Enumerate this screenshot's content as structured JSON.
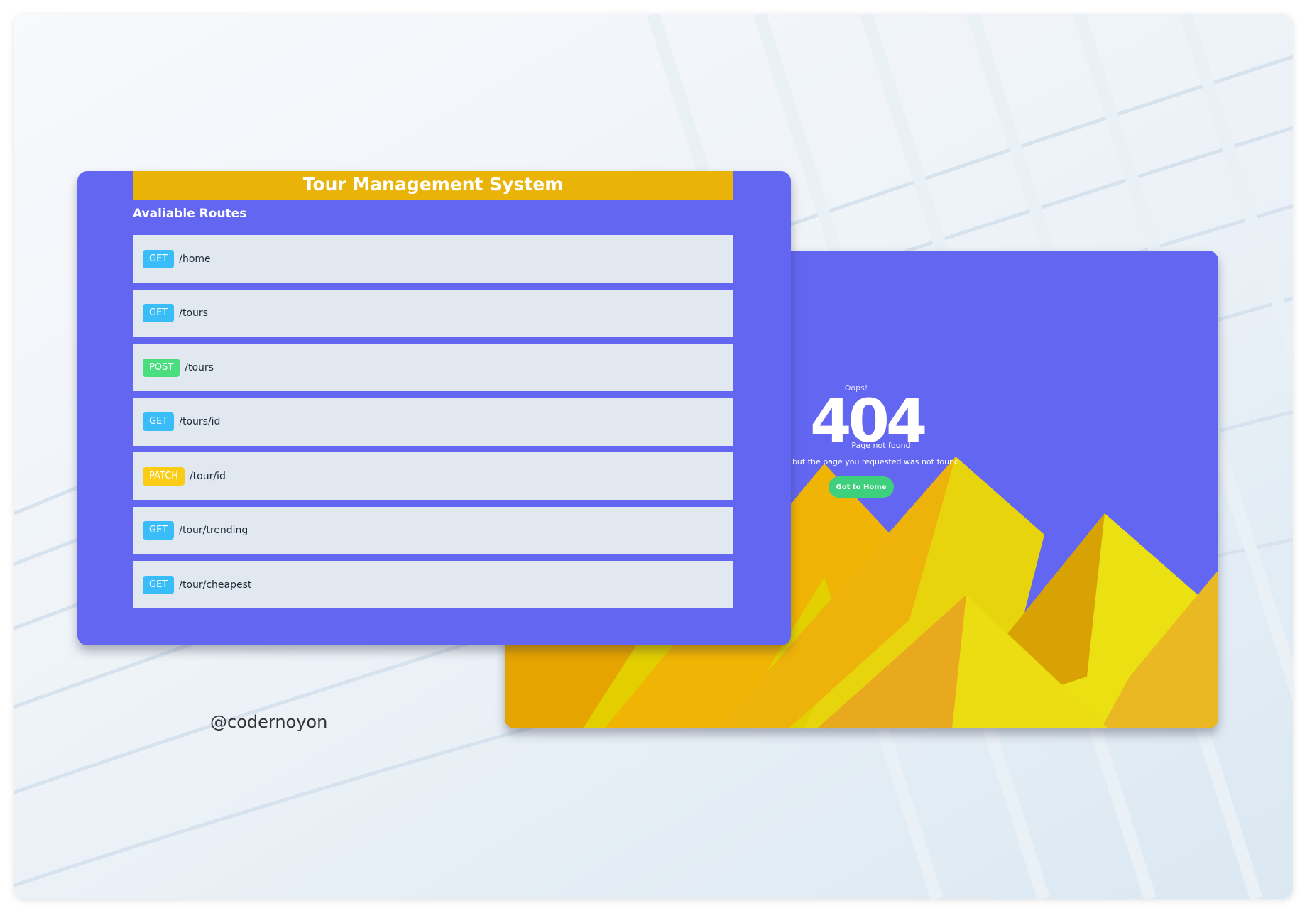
{
  "watermark": "@codernoyon",
  "routes_card": {
    "title": "Tour Management System",
    "subtitle": "Avaliable Routes",
    "routes": [
      {
        "method": "GET",
        "path": "/home"
      },
      {
        "method": "GET",
        "path": "/tours"
      },
      {
        "method": "POST",
        "path": "/tours"
      },
      {
        "method": "GET",
        "path": "/tours/id"
      },
      {
        "method": "PATCH",
        "path": "/tour/id"
      },
      {
        "method": "GET",
        "path": "/tour/trending"
      },
      {
        "method": "GET",
        "path": "/tour/cheapest"
      }
    ]
  },
  "error_card": {
    "oops": "Oops!",
    "code": "404",
    "heading": "Page not found",
    "message": "Sorry, but the page you requested was not found",
    "button_label": "Got to Home"
  },
  "colors": {
    "card_background": "#6366f1",
    "title_bar": "#eab308",
    "route_row": "#e2e8f0",
    "get_badge": "#38bdf8",
    "post_badge": "#4ade80",
    "patch_badge": "#facc15",
    "home_button": "#3fd07e"
  }
}
